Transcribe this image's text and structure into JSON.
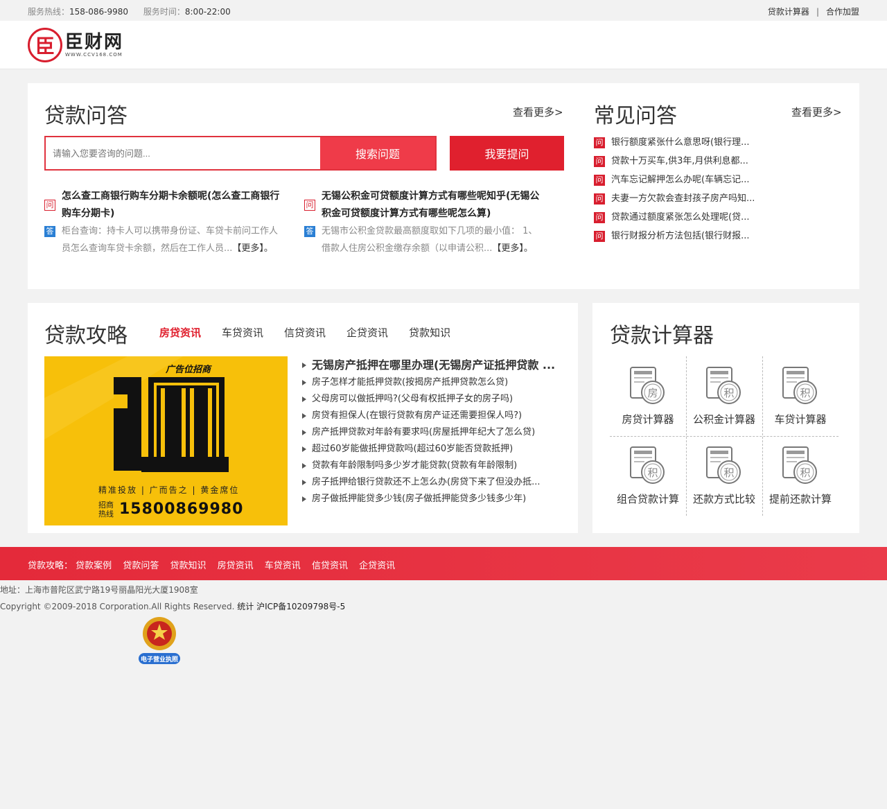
{
  "topbar": {
    "hotline_label": "服务热线：",
    "hotline": "158-086-9980",
    "hours_label": "服务时间：",
    "hours": "8:00-22:00",
    "links": [
      "贷款计算器",
      "合作加盟"
    ],
    "sep": "|"
  },
  "logo": {
    "mark": "臣",
    "name": "臣财网",
    "url": "WWW.CCV168.COM"
  },
  "qa_section": {
    "title": "贷款问答",
    "more": "查看更多>",
    "search_placeholder": "请输入您要咨询的问题...",
    "search_button": "搜索问题",
    "ask_button": "我要提问",
    "q_tag": "问",
    "a_tag": "答",
    "items": [
      {
        "q": "怎么查工商银行购车分期卡余额呢(怎么查工商银行购车分期卡)",
        "a": "柜台查询：持卡人可以携带身份证、车贷卡前问工作人员怎么查询车贷卡余额，然后在工作人员...",
        "more": "【更多】。"
      },
      {
        "q": "无锡公积金可贷额度计算方式有哪些呢知乎(无锡公积金可贷额度计算方式有哪些呢怎么算)",
        "a": "无锡市公积金贷款最高额度取如下几项的最小值： 1、借款人住房公积金缴存余额（以申请公积...",
        "more": "【更多】。"
      }
    ]
  },
  "faq_section": {
    "title": "常见问答",
    "more": "查看更多>",
    "items": [
      "银行额度紧张什么意思呀(银行理...",
      "贷款十万买车,供3年,月供利息都...",
      "汽车忘记解押怎么办呢(车辆忘记...",
      "夫妻一方欠款会查封孩子房产吗知...",
      "贷款通过额度紧张怎么处理呢(贷...",
      "银行财报分析方法包括(银行财报..."
    ]
  },
  "strategy_section": {
    "title": "贷款攻略",
    "tabs": [
      "房贷资讯",
      "车贷资讯",
      "信贷资讯",
      "企贷资讯",
      "贷款知识"
    ],
    "ad": {
      "top": "广告位招商",
      "slogan": "精准投放 | 广而告之 | 黄金席位",
      "hotline_label": "招商热线",
      "phone": "15800869980"
    },
    "news": [
      "无锡房产抵押在哪里办理(无锡房产证抵押贷款 ...",
      "房子怎样才能抵押贷款(按揭房产抵押贷款怎么贷)",
      "父母房可以做抵押吗?(父母有权抵押子女的房子吗)",
      "房贷有担保人(在银行贷款有房产证还需要担保人吗?)",
      "房产抵押贷款对年龄有要求吗(房屋抵押年纪大了怎么贷)",
      "超过60岁能做抵押贷款吗(超过60岁能否贷款抵押)",
      "贷款有年龄限制吗多少岁才能贷款(贷款有年龄限制)",
      "房子抵押给银行贷款还不上怎么办(房贷下来了但没办抵...",
      "房子做抵押能贷多少钱(房子做抵押能贷多少钱多少年)"
    ]
  },
  "calc_section": {
    "title": "贷款计算器",
    "items": [
      {
        "label": "房贷计算器",
        "glyph": "房"
      },
      {
        "label": "公积金计算器",
        "glyph": "积"
      },
      {
        "label": "车贷计算器",
        "glyph": "积"
      },
      {
        "label": "组合贷款计算",
        "glyph": "积"
      },
      {
        "label": "还款方式比较",
        "glyph": "积"
      },
      {
        "label": "提前还款计算",
        "glyph": "积"
      }
    ]
  },
  "footer": {
    "label": "贷款攻略：",
    "links": [
      "贷款案例",
      "贷款问答",
      "贷款知识",
      "房贷资讯",
      "车贷资讯",
      "信贷资讯",
      "企贷资讯"
    ],
    "address": "地址：上海市普陀区武宁路19号丽晶阳光大厦1908室",
    "copyright": "Copyright ©2009-2018 Corporation.All Rights Reserved.",
    "stat": "统计",
    "icp": "沪ICP备10209798号-5",
    "badge": "电子营业执照"
  }
}
